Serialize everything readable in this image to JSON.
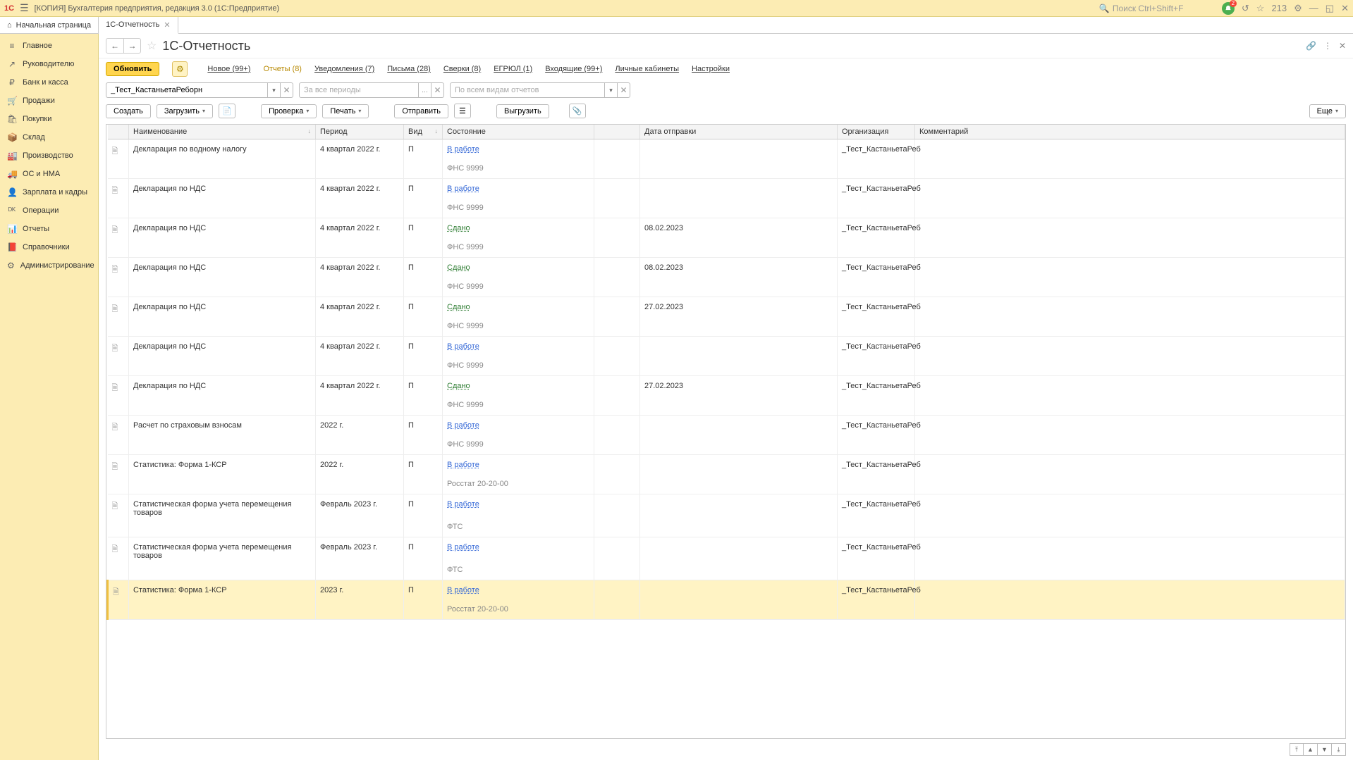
{
  "window_title": "[КОПИЯ] Бухгалтерия предприятия, редакция 3.0  (1С:Предприятие)",
  "search_placeholder": "Поиск Ctrl+Shift+F",
  "notif_count": "213",
  "tabs": {
    "home": "Начальная страница",
    "active": "1С-Отчетность"
  },
  "sidebar": [
    {
      "icon": "≡",
      "label": "Главное"
    },
    {
      "icon": "↗",
      "label": "Руководителю"
    },
    {
      "icon": "₽",
      "label": "Банк и касса"
    },
    {
      "icon": "🛒",
      "label": "Продажи"
    },
    {
      "icon": "🛍",
      "label": "Покупки"
    },
    {
      "icon": "📦",
      "label": "Склад"
    },
    {
      "icon": "🏭",
      "label": "Производство"
    },
    {
      "icon": "🚚",
      "label": "ОС и НМА"
    },
    {
      "icon": "👤",
      "label": "Зарплата и кадры"
    },
    {
      "icon": "ᴰᴷ",
      "label": "Операции"
    },
    {
      "icon": "📊",
      "label": "Отчеты"
    },
    {
      "icon": "📕",
      "label": "Справочники"
    },
    {
      "icon": "⚙",
      "label": "Администрирование"
    }
  ],
  "page_title": "1С-Отчетность",
  "refresh_btn": "Обновить",
  "linktabs": [
    {
      "label": "Новое (99+)"
    },
    {
      "label": "Отчеты (8)",
      "active": true
    },
    {
      "label": "Уведомления (7)"
    },
    {
      "label": "Письма (28)"
    },
    {
      "label": "Сверки (8)"
    },
    {
      "label": "ЕГРЮЛ (1)"
    },
    {
      "label": "Входящие (99+)"
    },
    {
      "label": "Личные кабинеты"
    },
    {
      "label": "Настройки"
    }
  ],
  "filters": {
    "org_value": "_Тест_КастаньетаРеборн",
    "period_placeholder": "За все периоды",
    "type_placeholder": "По всем видам отчетов"
  },
  "toolbar": {
    "create": "Создать",
    "load": "Загрузить",
    "check": "Проверка",
    "print": "Печать",
    "send": "Отправить",
    "export": "Выгрузить",
    "more": "Еще"
  },
  "columns": {
    "name": "Наименование",
    "period": "Период",
    "vid": "Вид",
    "status": "Состояние",
    "date": "Дата отправки",
    "org": "Организация",
    "comment": "Комментарий"
  },
  "rows": [
    {
      "name": "Декларация по водному налогу",
      "period": "4 квартал 2022 г.",
      "vid": "П",
      "status": "В работе",
      "status_kind": "work",
      "sub": "ФНС 9999",
      "date": "",
      "org": "_Тест_КастаньетаРеб"
    },
    {
      "name": "Декларация по НДС",
      "period": "4 квартал 2022 г.",
      "vid": "П",
      "status": "В работе",
      "status_kind": "work",
      "sub": "ФНС 9999",
      "date": "",
      "org": "_Тест_КастаньетаРеб"
    },
    {
      "name": "Декларация по НДС",
      "period": "4 квартал 2022 г.",
      "vid": "П",
      "status": "Сдано",
      "status_kind": "ok",
      "sub": "ФНС 9999",
      "date": "08.02.2023",
      "org": "_Тест_КастаньетаРеб"
    },
    {
      "name": "Декларация по НДС",
      "period": "4 квартал 2022 г.",
      "vid": "П",
      "status": "Сдано",
      "status_kind": "ok",
      "sub": "ФНС 9999",
      "date": "08.02.2023",
      "org": "_Тест_КастаньетаРеб"
    },
    {
      "name": "Декларация по НДС",
      "period": "4 квартал 2022 г.",
      "vid": "П",
      "status": "Сдано",
      "status_kind": "ok",
      "sub": "ФНС 9999",
      "date": "27.02.2023",
      "org": "_Тест_КастаньетаРеб"
    },
    {
      "name": "Декларация по НДС",
      "period": "4 квартал 2022 г.",
      "vid": "П",
      "status": "В работе",
      "status_kind": "work",
      "sub": "ФНС 9999",
      "date": "",
      "org": "_Тест_КастаньетаРеб"
    },
    {
      "name": "Декларация по НДС",
      "period": "4 квартал 2022 г.",
      "vid": "П",
      "status": "Сдано",
      "status_kind": "ok",
      "sub": "ФНС 9999",
      "date": "27.02.2023",
      "org": "_Тест_КастаньетаРеб"
    },
    {
      "name": "Расчет по страховым взносам",
      "period": "2022 г.",
      "vid": "П",
      "status": "В работе",
      "status_kind": "work",
      "sub": "ФНС 9999",
      "date": "",
      "org": "_Тест_КастаньетаРеб"
    },
    {
      "name": "Статистика: Форма 1-КСР",
      "period": "2022 г.",
      "vid": "П",
      "status": "В работе",
      "status_kind": "work",
      "sub": "Росстат 20-20-00",
      "date": "",
      "org": "_Тест_КастаньетаРеб"
    },
    {
      "name": "Статистическая форма учета перемещения товаров",
      "period": "Февраль 2023 г.",
      "vid": "П",
      "status": "В работе",
      "status_kind": "work",
      "sub": "ФТС",
      "date": "",
      "org": "_Тест_КастаньетаРеб"
    },
    {
      "name": "Статистическая форма учета перемещения товаров",
      "period": "Февраль 2023 г.",
      "vid": "П",
      "status": "В работе",
      "status_kind": "work",
      "sub": "ФТС",
      "date": "",
      "org": "_Тест_КастаньетаРеб"
    },
    {
      "name": "Статистика: Форма 1-КСР",
      "period": "2023 г.",
      "vid": "П",
      "status": "В работе",
      "status_kind": "work",
      "sub": "Росстат 20-20-00",
      "date": "",
      "org": "_Тест_КастаньетаРеб",
      "selected": true
    }
  ]
}
